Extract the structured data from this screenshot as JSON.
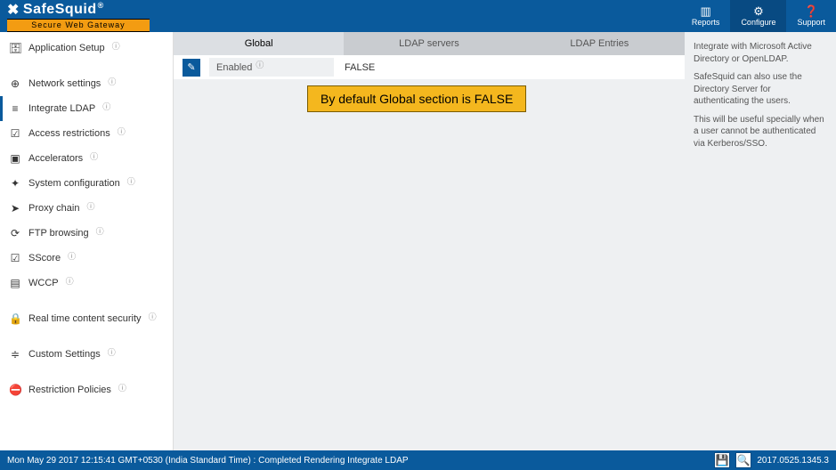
{
  "brand": {
    "name": "SafeSquid",
    "registered": "®",
    "tagline": "Secure Web Gateway"
  },
  "topnav": {
    "reports": "Reports",
    "configure": "Configure",
    "support": "Support"
  },
  "sidebar": {
    "items": [
      {
        "label": "Application Setup"
      },
      {
        "label": "Network settings"
      },
      {
        "label": "Integrate LDAP"
      },
      {
        "label": "Access restrictions"
      },
      {
        "label": "Accelerators"
      },
      {
        "label": "System configuration"
      },
      {
        "label": "Proxy chain"
      },
      {
        "label": "FTP browsing"
      },
      {
        "label": "SScore"
      },
      {
        "label": "WCCP"
      },
      {
        "label": "Real time content security"
      },
      {
        "label": "Custom Settings"
      },
      {
        "label": "Restriction Policies"
      }
    ]
  },
  "tabs": {
    "global": "Global",
    "ldap_servers": "LDAP servers",
    "ldap_entries": "LDAP Entries"
  },
  "config": {
    "enabled_label": "Enabled",
    "enabled_value": "FALSE"
  },
  "callout": "By default Global section is FALSE",
  "help": {
    "p1": "Integrate with Microsoft Active Directory or OpenLDAP.",
    "p2": "SafeSquid can also use the Directory Server for authenticating the users.",
    "p3": "This will be useful specially when a user cannot be authenticated via Kerberos/SSO."
  },
  "footer": {
    "status": "Mon May 29 2017 12:15:41 GMT+0530 (India Standard Time) : Completed Rendering Integrate LDAP",
    "version": "2017.0525.1345.3"
  }
}
